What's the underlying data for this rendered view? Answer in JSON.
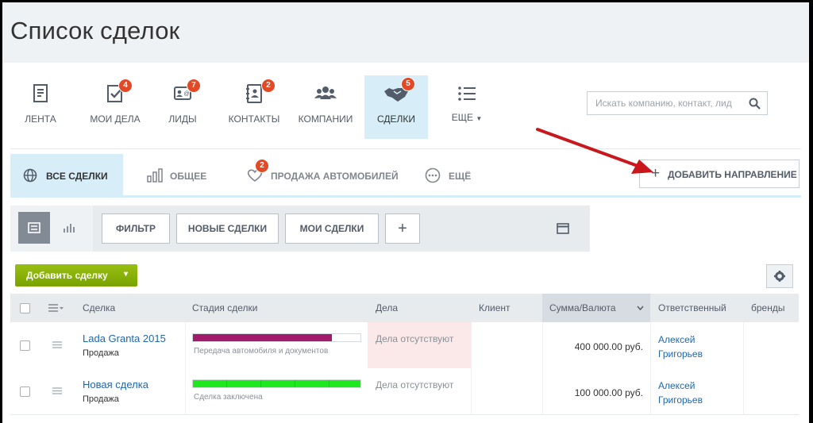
{
  "page": {
    "title": "Список сделок"
  },
  "nav": {
    "items": [
      {
        "label": "ЛЕНТА",
        "icon": "feed-icon"
      },
      {
        "label": "МОИ ДЕЛА",
        "icon": "tasks-icon",
        "badge": "4"
      },
      {
        "label": "ЛИДЫ",
        "icon": "leads-icon",
        "badge": "7"
      },
      {
        "label": "КОНТАКТЫ",
        "icon": "contacts-icon",
        "badge": "2"
      },
      {
        "label": "КОМПАНИИ",
        "icon": "companies-icon"
      },
      {
        "label": "СДЕЛКИ",
        "icon": "handshake-icon",
        "badge": "5",
        "active": true
      },
      {
        "label": "ЕЩЕ",
        "icon": "list-icon"
      }
    ],
    "search_placeholder": "Искать компанию, контакт, лид"
  },
  "tabs": {
    "items": [
      {
        "label": "ВСЕ СДЕЛКИ",
        "icon": "globe-icon",
        "active": true
      },
      {
        "label": "ОБЩЕЕ",
        "icon": "bar-chart-icon"
      },
      {
        "label": "ПРОДАЖА АВТОМОБИЛЕЙ",
        "icon": "heart-icon",
        "badge": "2"
      },
      {
        "label": "ЕЩЁ",
        "icon": "more-icon"
      }
    ],
    "add_direction": "ДОБАВИТЬ НАПРАВЛЕНИЕ"
  },
  "filters": {
    "filter": "ФИЛЬТР",
    "new_deals": "НОВЫЕ СДЕЛКИ",
    "my_deals": "МОИ СДЕЛКИ",
    "add": "+"
  },
  "toolbar": {
    "add_deal": "Добавить сделку"
  },
  "table": {
    "columns": {
      "deal": "Сделка",
      "stage": "Стадия сделки",
      "tasks": "Дела",
      "client": "Клиент",
      "sum": "Сумма/Валюта",
      "responsible": "Ответственный",
      "brands": "бренды"
    },
    "rows": [
      {
        "name": "Lada Granta 2015",
        "direction": "Продажа",
        "stage": "Передача автомобиля и документов",
        "stage_color": "#a21a6a",
        "stage_progress": 0.83,
        "tasks": "Дела отсутствуют",
        "tasks_highlight": true,
        "sum": "400 000.00 руб.",
        "responsible_first": "Алексей",
        "responsible_last": "Григорьев"
      },
      {
        "name": "Новая сделка",
        "direction": "Продажа",
        "stage": "Сделка заключена",
        "stage_color": "#1ee81e",
        "stage_progress": 1.0,
        "tasks": "Дела отсутствуют",
        "tasks_highlight": false,
        "sum": "100 000.00 руб.",
        "responsible_first": "Алексей",
        "responsible_last": "Григорьев"
      }
    ]
  },
  "colors": {
    "accent_arrow": "#c8181e",
    "badge": "#e24a27",
    "active_bg": "#d7eef9",
    "green_button": "#86ad00"
  }
}
